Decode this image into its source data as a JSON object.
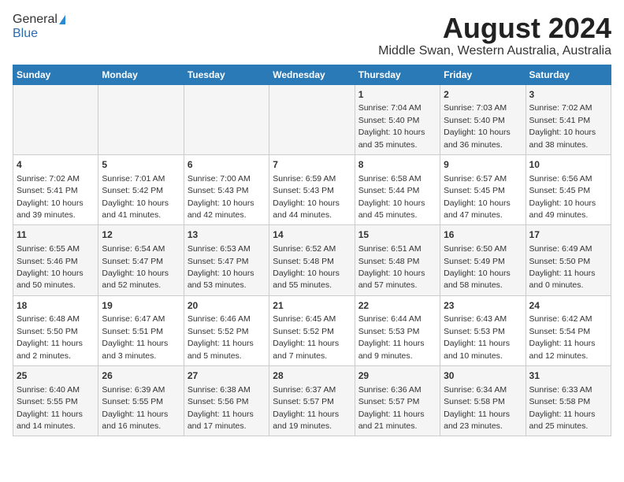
{
  "logo": {
    "line1": "General",
    "line2": "Blue"
  },
  "title": "August 2024",
  "subtitle": "Middle Swan, Western Australia, Australia",
  "days_of_week": [
    "Sunday",
    "Monday",
    "Tuesday",
    "Wednesday",
    "Thursday",
    "Friday",
    "Saturday"
  ],
  "weeks": [
    [
      {
        "day": "",
        "info": ""
      },
      {
        "day": "",
        "info": ""
      },
      {
        "day": "",
        "info": ""
      },
      {
        "day": "",
        "info": ""
      },
      {
        "day": "1",
        "info": "Sunrise: 7:04 AM\nSunset: 5:40 PM\nDaylight: 10 hours\nand 35 minutes."
      },
      {
        "day": "2",
        "info": "Sunrise: 7:03 AM\nSunset: 5:40 PM\nDaylight: 10 hours\nand 36 minutes."
      },
      {
        "day": "3",
        "info": "Sunrise: 7:02 AM\nSunset: 5:41 PM\nDaylight: 10 hours\nand 38 minutes."
      }
    ],
    [
      {
        "day": "4",
        "info": "Sunrise: 7:02 AM\nSunset: 5:41 PM\nDaylight: 10 hours\nand 39 minutes."
      },
      {
        "day": "5",
        "info": "Sunrise: 7:01 AM\nSunset: 5:42 PM\nDaylight: 10 hours\nand 41 minutes."
      },
      {
        "day": "6",
        "info": "Sunrise: 7:00 AM\nSunset: 5:43 PM\nDaylight: 10 hours\nand 42 minutes."
      },
      {
        "day": "7",
        "info": "Sunrise: 6:59 AM\nSunset: 5:43 PM\nDaylight: 10 hours\nand 44 minutes."
      },
      {
        "day": "8",
        "info": "Sunrise: 6:58 AM\nSunset: 5:44 PM\nDaylight: 10 hours\nand 45 minutes."
      },
      {
        "day": "9",
        "info": "Sunrise: 6:57 AM\nSunset: 5:45 PM\nDaylight: 10 hours\nand 47 minutes."
      },
      {
        "day": "10",
        "info": "Sunrise: 6:56 AM\nSunset: 5:45 PM\nDaylight: 10 hours\nand 49 minutes."
      }
    ],
    [
      {
        "day": "11",
        "info": "Sunrise: 6:55 AM\nSunset: 5:46 PM\nDaylight: 10 hours\nand 50 minutes."
      },
      {
        "day": "12",
        "info": "Sunrise: 6:54 AM\nSunset: 5:47 PM\nDaylight: 10 hours\nand 52 minutes."
      },
      {
        "day": "13",
        "info": "Sunrise: 6:53 AM\nSunset: 5:47 PM\nDaylight: 10 hours\nand 53 minutes."
      },
      {
        "day": "14",
        "info": "Sunrise: 6:52 AM\nSunset: 5:48 PM\nDaylight: 10 hours\nand 55 minutes."
      },
      {
        "day": "15",
        "info": "Sunrise: 6:51 AM\nSunset: 5:48 PM\nDaylight: 10 hours\nand 57 minutes."
      },
      {
        "day": "16",
        "info": "Sunrise: 6:50 AM\nSunset: 5:49 PM\nDaylight: 10 hours\nand 58 minutes."
      },
      {
        "day": "17",
        "info": "Sunrise: 6:49 AM\nSunset: 5:50 PM\nDaylight: 11 hours\nand 0 minutes."
      }
    ],
    [
      {
        "day": "18",
        "info": "Sunrise: 6:48 AM\nSunset: 5:50 PM\nDaylight: 11 hours\nand 2 minutes."
      },
      {
        "day": "19",
        "info": "Sunrise: 6:47 AM\nSunset: 5:51 PM\nDaylight: 11 hours\nand 3 minutes."
      },
      {
        "day": "20",
        "info": "Sunrise: 6:46 AM\nSunset: 5:52 PM\nDaylight: 11 hours\nand 5 minutes."
      },
      {
        "day": "21",
        "info": "Sunrise: 6:45 AM\nSunset: 5:52 PM\nDaylight: 11 hours\nand 7 minutes."
      },
      {
        "day": "22",
        "info": "Sunrise: 6:44 AM\nSunset: 5:53 PM\nDaylight: 11 hours\nand 9 minutes."
      },
      {
        "day": "23",
        "info": "Sunrise: 6:43 AM\nSunset: 5:53 PM\nDaylight: 11 hours\nand 10 minutes."
      },
      {
        "day": "24",
        "info": "Sunrise: 6:42 AM\nSunset: 5:54 PM\nDaylight: 11 hours\nand 12 minutes."
      }
    ],
    [
      {
        "day": "25",
        "info": "Sunrise: 6:40 AM\nSunset: 5:55 PM\nDaylight: 11 hours\nand 14 minutes."
      },
      {
        "day": "26",
        "info": "Sunrise: 6:39 AM\nSunset: 5:55 PM\nDaylight: 11 hours\nand 16 minutes."
      },
      {
        "day": "27",
        "info": "Sunrise: 6:38 AM\nSunset: 5:56 PM\nDaylight: 11 hours\nand 17 minutes."
      },
      {
        "day": "28",
        "info": "Sunrise: 6:37 AM\nSunset: 5:57 PM\nDaylight: 11 hours\nand 19 minutes."
      },
      {
        "day": "29",
        "info": "Sunrise: 6:36 AM\nSunset: 5:57 PM\nDaylight: 11 hours\nand 21 minutes."
      },
      {
        "day": "30",
        "info": "Sunrise: 6:34 AM\nSunset: 5:58 PM\nDaylight: 11 hours\nand 23 minutes."
      },
      {
        "day": "31",
        "info": "Sunrise: 6:33 AM\nSunset: 5:58 PM\nDaylight: 11 hours\nand 25 minutes."
      }
    ]
  ]
}
